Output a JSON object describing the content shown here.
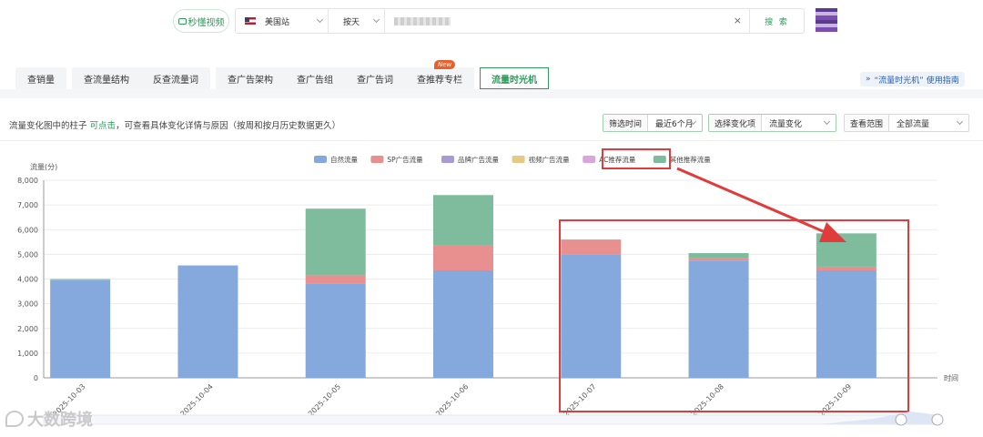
{
  "top": {
    "video_label": "秒懂视频",
    "site": "美国站",
    "mode": "按天",
    "search_label": "搜 索",
    "clear": "×"
  },
  "tabs": {
    "group1": [
      "查销量"
    ],
    "group2": [
      "查流量结构",
      "反查流量词"
    ],
    "group3": [
      "查广告架构",
      "查广告组",
      "查广告词",
      "查推荐专栏"
    ],
    "active": "流量时光机",
    "new_badge": "New",
    "guide": "“流量时光机” 使用指南",
    "guide_icon": "double-chevron-down-icon"
  },
  "filters": {
    "hint_prefix": "流量变化图中的柱子",
    "hint_click": "可点击",
    "hint_suffix": "，可查看具体变化详情与原因（按周和按月历史数据更久）",
    "time_label": "筛选时间",
    "time_value": "最近6个月",
    "change_label": "选择变化项",
    "change_value": "流量变化",
    "scope_label": "查看范围",
    "scope_value": "全部流量"
  },
  "watermark": "大数跨境",
  "chart_data": {
    "type": "bar",
    "stacked": true,
    "ylabel": "流量(分)",
    "xlabel": "时间",
    "ylim": [
      0,
      8000
    ],
    "yticks": [
      "0",
      "1,000",
      "2,000",
      "3,000",
      "4,000",
      "5,000",
      "6,000",
      "7,000",
      "8,000"
    ],
    "categories": [
      "2025-10-03",
      "2025-10-04",
      "2025-10-05",
      "2025-10-06",
      "2025-10-07",
      "2025-10-08",
      "2025-10-09"
    ],
    "series": [
      {
        "name": "自然流量",
        "color": "#86a9dd",
        "values": [
          3950,
          4550,
          3800,
          4350,
          5000,
          4750,
          4350
        ]
      },
      {
        "name": "SP广告流量",
        "color": "#e89090",
        "values": [
          30,
          0,
          350,
          1000,
          600,
          100,
          150
        ]
      },
      {
        "name": "品牌广告流量",
        "color": "#a99ad6",
        "values": [
          0,
          0,
          0,
          0,
          0,
          0,
          0
        ]
      },
      {
        "name": "视频广告流量",
        "color": "#e6c982",
        "values": [
          0,
          0,
          0,
          0,
          0,
          0,
          0
        ]
      },
      {
        "name": "AC推荐流量",
        "color": "#d9a6d9",
        "values": [
          0,
          0,
          0,
          0,
          0,
          0,
          0
        ]
      },
      {
        "name": "其他推荐流量",
        "color": "#7fbc9e",
        "values": [
          20,
          0,
          2700,
          2050,
          0,
          200,
          1350
        ]
      }
    ],
    "legend_position": "top",
    "grid": true,
    "annotation_color": "#e03c3c"
  }
}
